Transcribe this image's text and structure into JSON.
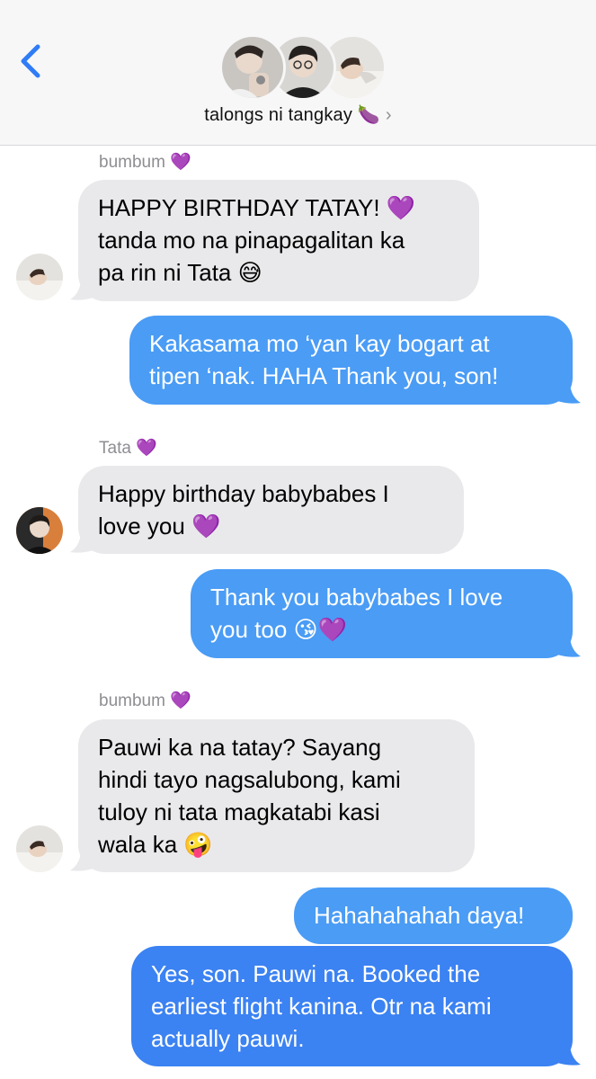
{
  "header": {
    "group_name": "talongs ni tangkay 🍆",
    "chevron": "›"
  },
  "messages": [
    {
      "sender": "bumbum 💜",
      "lines": [
        "HAPPY BIRTHDAY TATAY! 💜",
        "tanda mo na pinapagalitan ka",
        "pa rin ni Tata 😅"
      ]
    },
    {
      "lines": [
        "Kakasama mo ‘yan kay bogart at",
        "tipen ‘nak. HAHA Thank you, son!"
      ]
    },
    {
      "sender": "Tata 💜",
      "lines": [
        "Happy birthday babybabes I",
        "love you 💜"
      ]
    },
    {
      "lines": [
        "Thank you babybabes I love",
        "you too 😘💜"
      ]
    },
    {
      "sender": "bumbum 💜",
      "lines": [
        "Pauwi ka na tatay? Sayang",
        "hindi tayo nagsalubong, kami",
        "tuloy ni tata magkatabi kasi",
        "wala ka 🤪"
      ]
    },
    {
      "lines": [
        "Hahahahahah daya!"
      ]
    },
    {
      "lines": [
        "Yes, son. Pauwi na. Booked the",
        "earliest flight kanina. Otr na kami",
        "actually pauwi."
      ]
    }
  ],
  "colors": {
    "incoming": "#e9e9eb",
    "outgoing": "#4a9cf5",
    "outgoing_latest": "#3b82f2",
    "accent": "#2f7cf6"
  },
  "icons": {
    "back": "chevron-left-icon",
    "details": "chevron-right-icon"
  }
}
